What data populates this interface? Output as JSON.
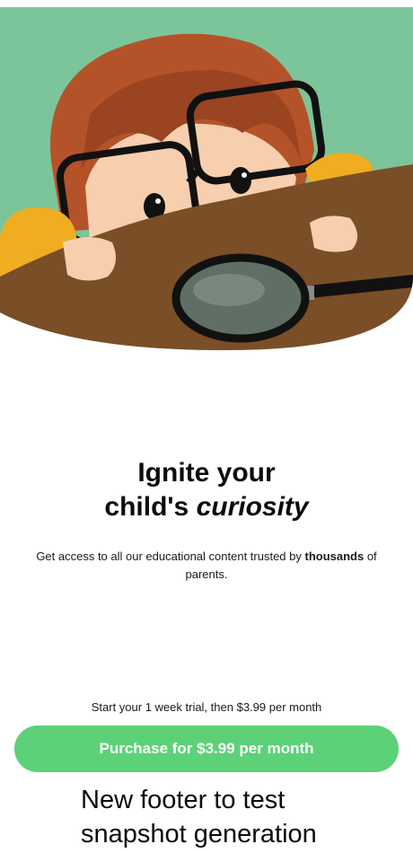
{
  "hero": {
    "image": "child-with-magnifying-glass-illustration",
    "colors": {
      "background": "#7cc49a",
      "hair": "#b4532a",
      "sleeves": "#f0ad22",
      "table": "#7a4e27",
      "skin": "#f7cfae"
    }
  },
  "headline": {
    "line1": "Ignite your",
    "line2_prefix": "child's ",
    "line2_emphasis": "curiosity"
  },
  "subtitle": {
    "prefix": "Get access to all our educational content trusted by ",
    "emphasis": "thousands",
    "suffix": " of parents."
  },
  "trial_text": "Start your 1 week trial, then $3.99 per month",
  "purchase_button": {
    "label": "Purchase for $3.99 per month",
    "color": "#5dd178"
  },
  "footer_text": "New footer to test snapshot generation"
}
